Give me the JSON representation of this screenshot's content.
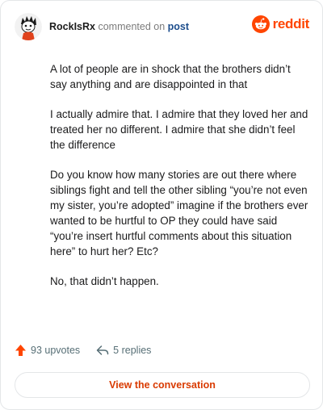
{
  "header": {
    "username": "RockIsRx",
    "action": "commented on",
    "post_link": "post"
  },
  "brand": {
    "wordmark": "reddit",
    "accent_color": "#ff4500",
    "icon": "reddit-logo-icon"
  },
  "comment": {
    "paragraphs": [
      "A lot of people are in shock that the brothers didn’t say anything and are disappointed in that",
      "I actually admire that. I admire that they loved her and treated her no different. I admire that she didn’t feel the difference",
      "Do you know how many stories are out there where siblings fight and tell the other sibling “you’re not even my sister, you’re adopted” imagine if the brothers ever wanted to be hurtful to OP they could have said “you’re insert hurtful comments about this situation here” to hurt her? Etc?",
      "No, that didn’t happen."
    ]
  },
  "footer": {
    "upvotes": "93 upvotes",
    "upvote_icon": "upvote-arrow-icon",
    "replies": "5 replies",
    "reply_icon": "reply-arrow-icon",
    "cta_label": "View the conversation"
  }
}
